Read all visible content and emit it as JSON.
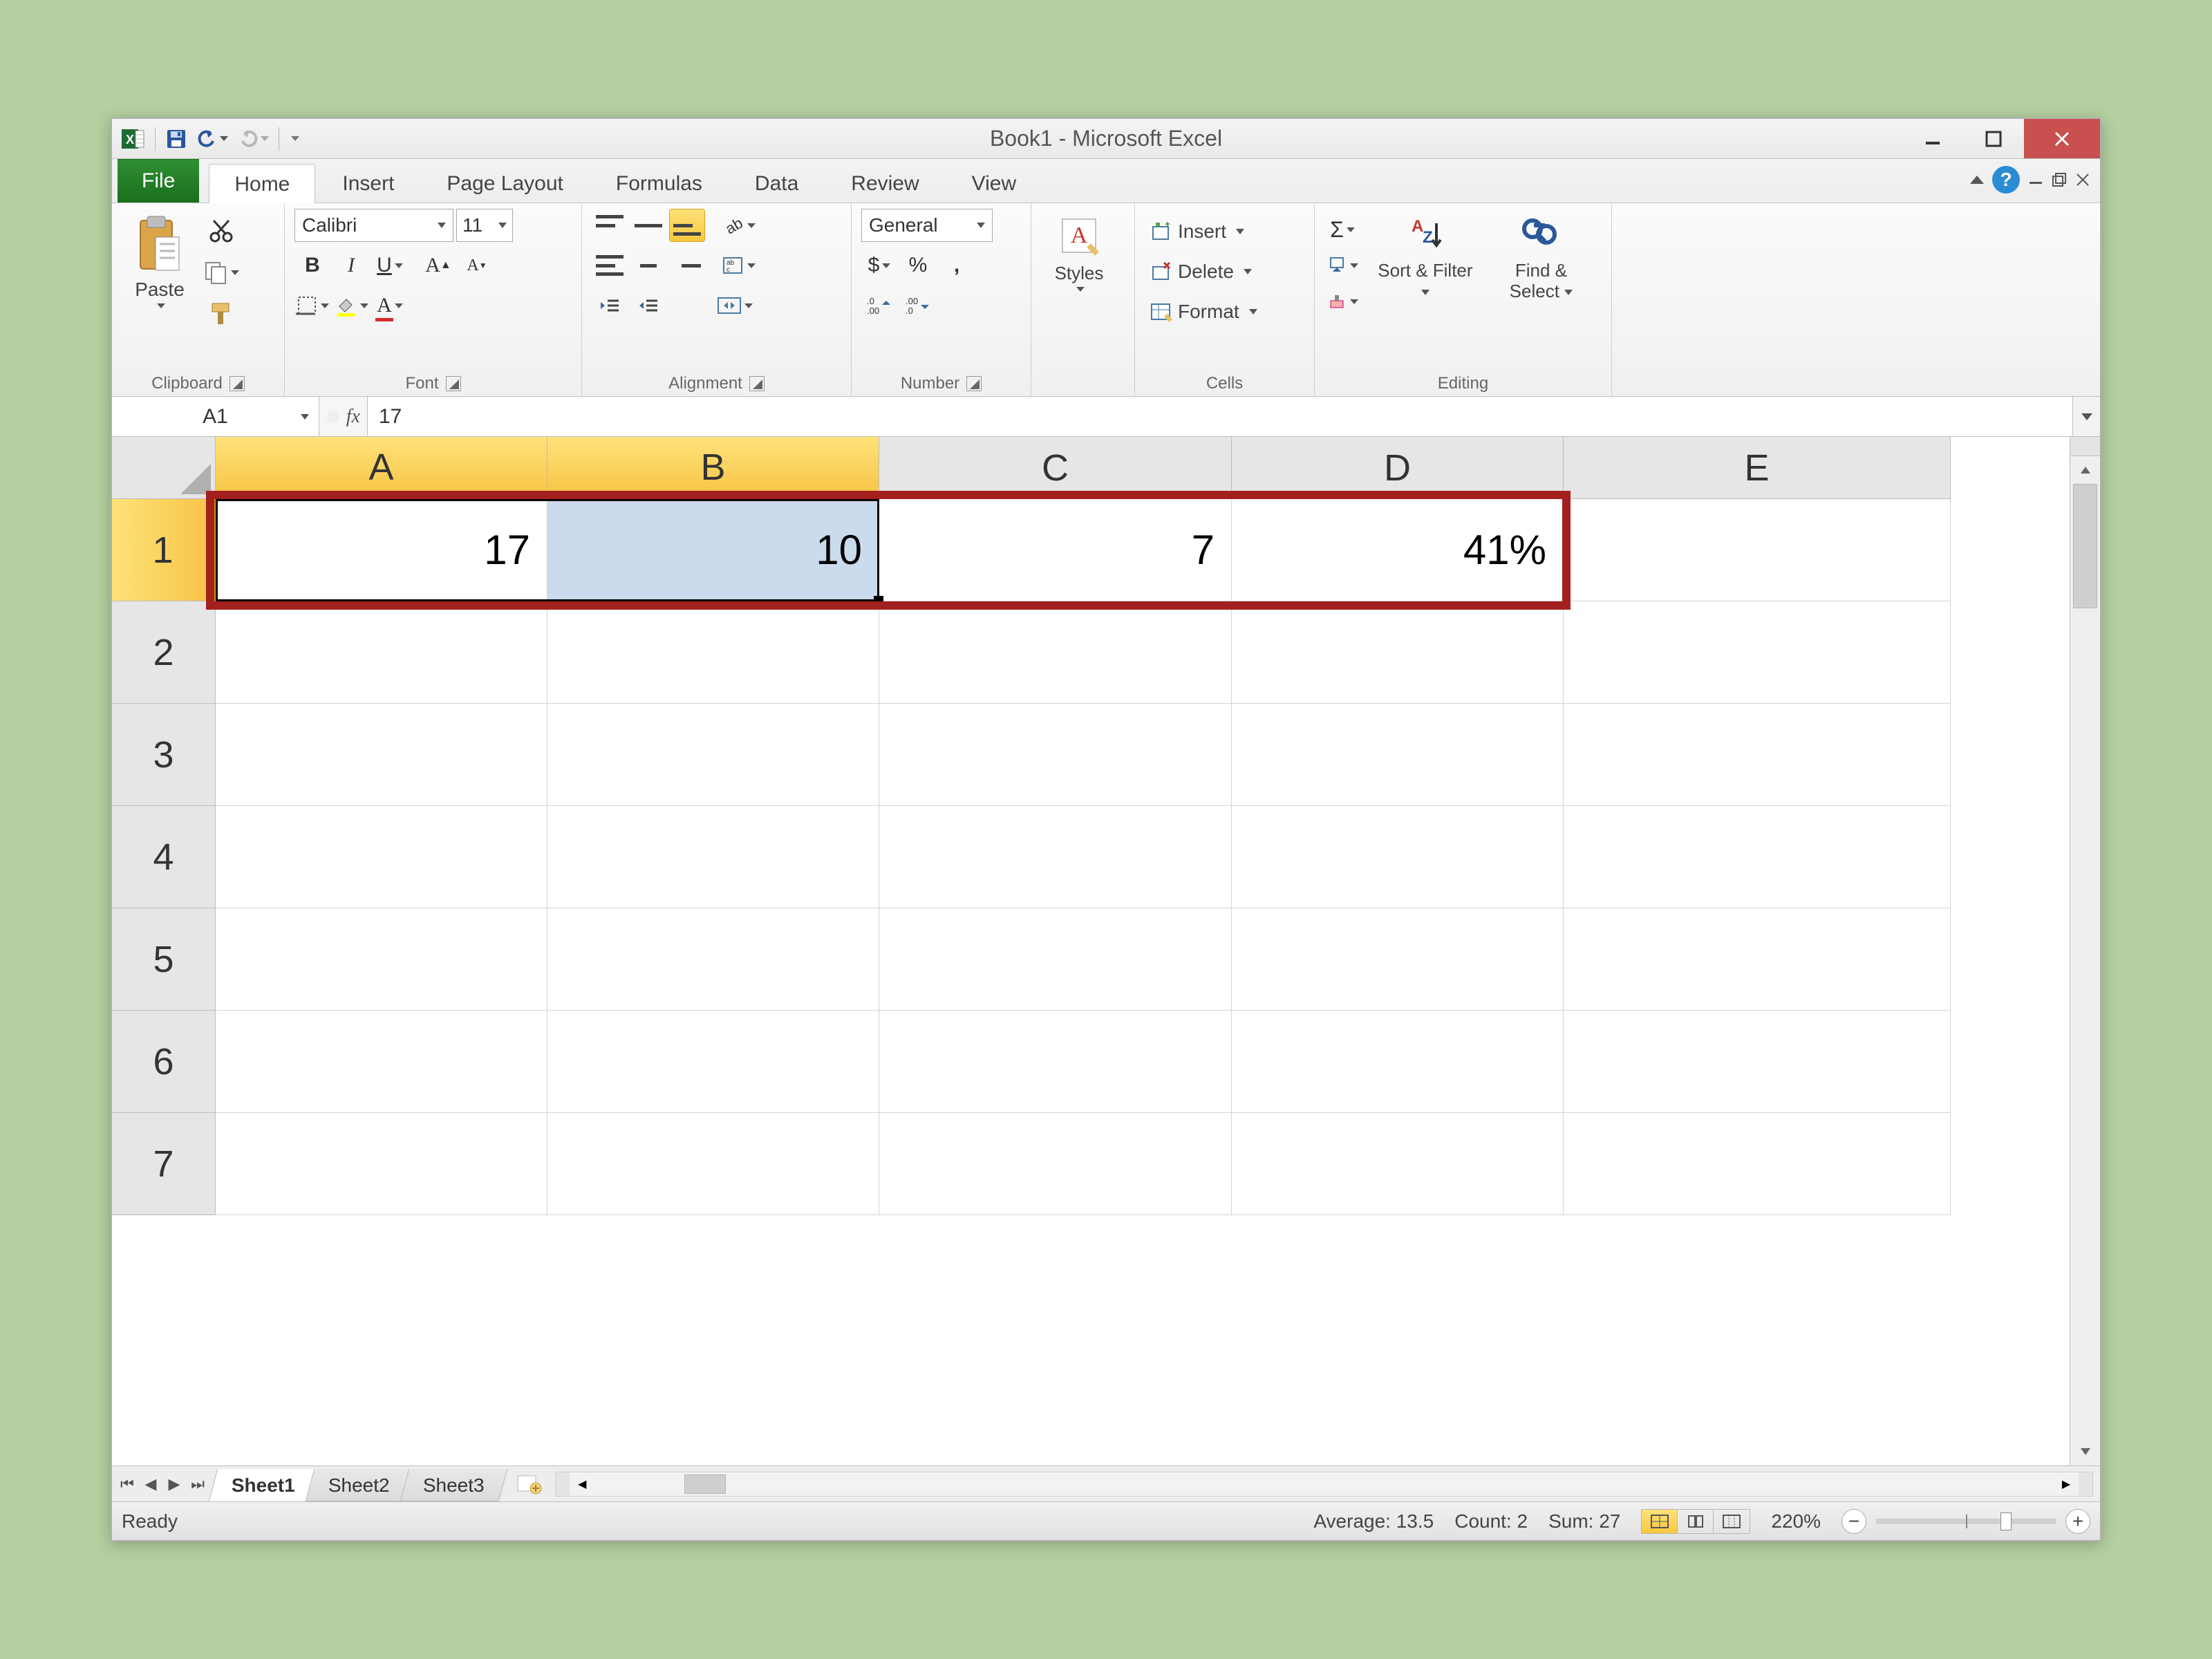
{
  "title": "Book1 - Microsoft Excel",
  "tabs": {
    "file": "File",
    "items": [
      "Home",
      "Insert",
      "Page Layout",
      "Formulas",
      "Data",
      "Review",
      "View"
    ],
    "active": "Home"
  },
  "ribbon": {
    "clipboard": {
      "label": "Clipboard",
      "paste": "Paste"
    },
    "font": {
      "label": "Font",
      "name": "Calibri",
      "size": "11",
      "bold": "B",
      "italic": "I",
      "underline": "U"
    },
    "alignment": {
      "label": "Alignment"
    },
    "number": {
      "label": "Number",
      "format": "General",
      "currency": "$",
      "percent": "%",
      "comma": ","
    },
    "styles": {
      "label": "Styles"
    },
    "cells": {
      "label": "Cells",
      "insert": "Insert",
      "delete": "Delete",
      "format": "Format"
    },
    "editing": {
      "label": "Editing",
      "sortfilter": "Sort & Filter",
      "findselect": "Find & Select",
      "sigma": "Σ"
    }
  },
  "formula_bar": {
    "namebox": "A1",
    "fx": "fx",
    "value": "17"
  },
  "columns": [
    "A",
    "B",
    "C",
    "D",
    "E"
  ],
  "rows": [
    "1",
    "2",
    "3",
    "4",
    "5",
    "6",
    "7"
  ],
  "cells": {
    "A1": "17",
    "B1": "10",
    "C1": "7",
    "D1": "41%"
  },
  "sheets": {
    "items": [
      "Sheet1",
      "Sheet2",
      "Sheet3"
    ],
    "active": "Sheet1"
  },
  "status": {
    "ready": "Ready",
    "average_label": "Average:",
    "average_value": "13.5",
    "count_label": "Count:",
    "count_value": "2",
    "sum_label": "Sum:",
    "sum_value": "27",
    "zoom": "220%"
  }
}
